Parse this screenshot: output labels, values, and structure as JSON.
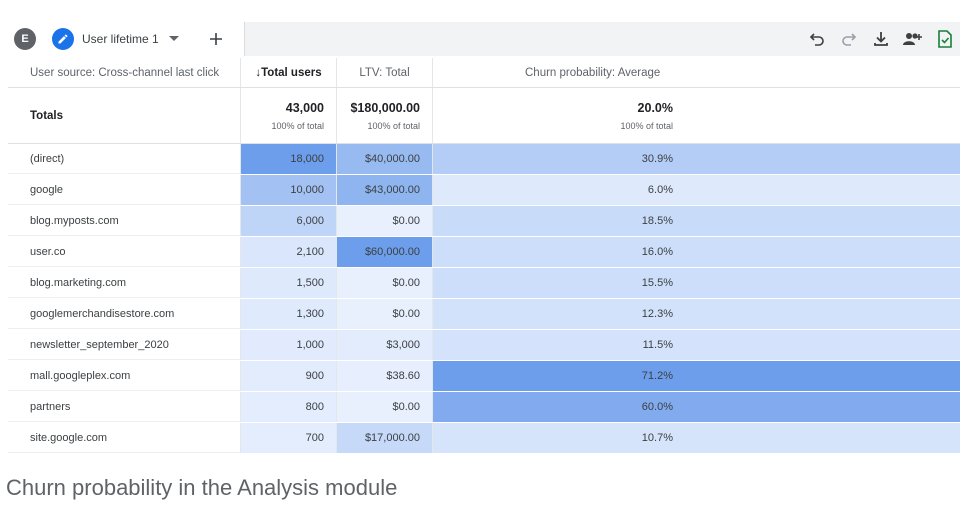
{
  "tabs": {
    "avatar_letter": "E",
    "active_tab_label": "User lifetime 1"
  },
  "toolbar": {
    "icons": [
      "undo-icon",
      "redo-icon",
      "download-icon",
      "share-users-icon",
      "export-sheet-icon"
    ]
  },
  "table": {
    "headers": {
      "dimension": "User source: Cross-channel last click",
      "total_users": "↓Total users",
      "ltv": "LTV: Total",
      "churn": "Churn probability: Average"
    },
    "totals": {
      "label": "Totals",
      "total_users": "43,000",
      "total_users_pct": "100% of total",
      "ltv": "$180,000.00",
      "ltv_pct": "100% of total",
      "churn": "20.0%",
      "churn_pct": "100% of total"
    },
    "rows": [
      {
        "source": "(direct)",
        "users": "18,000",
        "ltv": "$40,000.00",
        "churn": "30.9%",
        "users_level": 1.0,
        "ltv_level": 0.66,
        "churn_level": 0.43
      },
      {
        "source": "google",
        "users": "10,000",
        "ltv": "$43,000.00",
        "churn": "6.0%",
        "users_level": 0.56,
        "ltv_level": 0.72,
        "churn_level": 0.08
      },
      {
        "source": "blog.myposts.com",
        "users": "6,000",
        "ltv": "$0.00",
        "churn": "18.5%",
        "users_level": 0.33,
        "ltv_level": 0.0,
        "churn_level": 0.26
      },
      {
        "source": "user.co",
        "users": "2,100",
        "ltv": "$60,000.00",
        "churn": "16.0%",
        "users_level": 0.12,
        "ltv_level": 1.0,
        "churn_level": 0.22
      },
      {
        "source": "blog.marketing.com",
        "users": "1,500",
        "ltv": "$0.00",
        "churn": "15.5%",
        "users_level": 0.08,
        "ltv_level": 0.0,
        "churn_level": 0.22
      },
      {
        "source": "googlemerchandisestore.com",
        "users": "1,300",
        "ltv": "$0.00",
        "churn": "12.3%",
        "users_level": 0.07,
        "ltv_level": 0.0,
        "churn_level": 0.17
      },
      {
        "source": "newsletter_september_2020",
        "users": "1,000",
        "ltv": "$3,000",
        "churn": "11.5%",
        "users_level": 0.06,
        "ltv_level": 0.05,
        "churn_level": 0.16
      },
      {
        "source": "mall.googleplex.com",
        "users": "900",
        "ltv": "$38.60",
        "churn": "71.2%",
        "users_level": 0.05,
        "ltv_level": 0.01,
        "churn_level": 1.0
      },
      {
        "source": "partners",
        "users": "800",
        "ltv": "$0.00",
        "churn": "60.0%",
        "users_level": 0.04,
        "ltv_level": 0.0,
        "churn_level": 0.84
      },
      {
        "source": "site.google.com",
        "users": "700",
        "ltv": "$17,000.00",
        "churn": "10.7%",
        "users_level": 0.04,
        "ltv_level": 0.28,
        "churn_level": 0.15
      }
    ]
  },
  "colors": {
    "heat_low": "#e8f0fe",
    "heat_high": "#6d9eeb",
    "accent": "#1a73e8",
    "sheet_green": "#188038"
  },
  "caption": "Churn probability in the Analysis module"
}
